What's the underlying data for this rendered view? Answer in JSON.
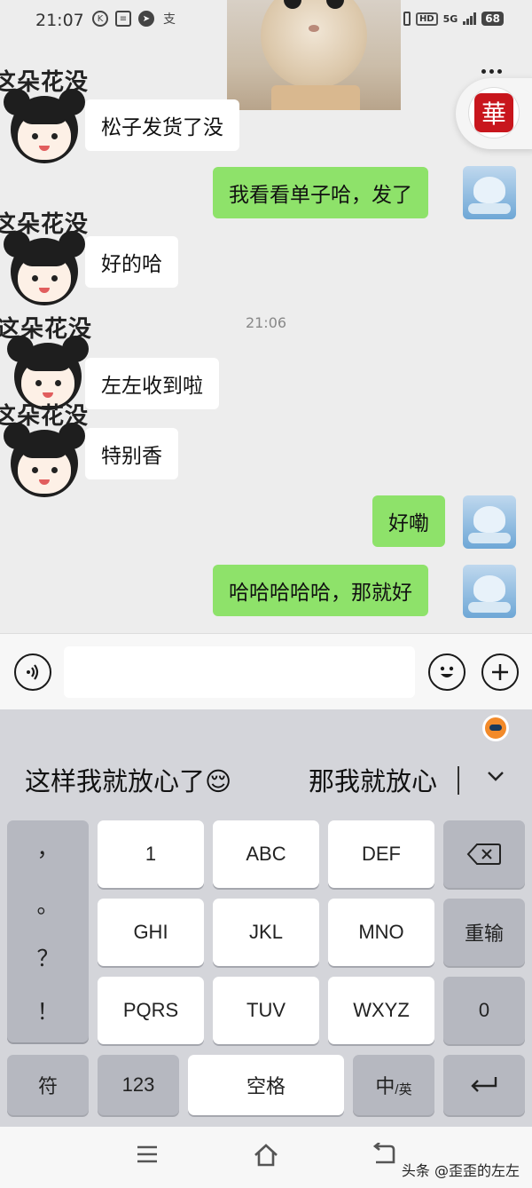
{
  "status_bar": {
    "time": "21:07",
    "left_icons": [
      "k-circle-icon",
      "sim-card-icon",
      "compass-icon",
      "alipay-icon"
    ],
    "hd": "HD",
    "network": "5G",
    "battery": "68"
  },
  "float": {
    "seal_char": "華"
  },
  "chat": {
    "messages": [
      {
        "side": "in",
        "sticker_caption": "这朵花没",
        "text": "松子发货了没"
      },
      {
        "side": "out",
        "text": "我看看单子哈，发了"
      },
      {
        "side": "in",
        "sticker_caption": "这朵花没",
        "text": "好的哈"
      },
      {
        "side": "in",
        "sticker_caption": "这朵花没",
        "text": "左左收到啦"
      },
      {
        "side": "in",
        "sticker_caption": "这朵花没",
        "text": "特别香"
      },
      {
        "side": "out",
        "text": "好嘞"
      },
      {
        "side": "out",
        "text": "哈哈哈哈哈，那就好"
      }
    ],
    "timestamp": "21:06"
  },
  "input_bar": {
    "value": ""
  },
  "keyboard": {
    "candidates": [
      "这样我就放心了😌",
      "那我就放心"
    ],
    "punctuation": [
      "，",
      "。",
      "？",
      "！"
    ],
    "rows": [
      [
        "1",
        "ABC",
        "DEF"
      ],
      [
        "GHI",
        "JKL",
        "MNO"
      ],
      [
        "PQRS",
        "TUV",
        "WXYZ"
      ]
    ],
    "reinput": "重输",
    "zero": "0",
    "symbols": "符",
    "numbers": "123",
    "space": "空格",
    "lang_main": "中",
    "lang_sub": "/英"
  },
  "watermark": "头条 @歪歪的左左"
}
